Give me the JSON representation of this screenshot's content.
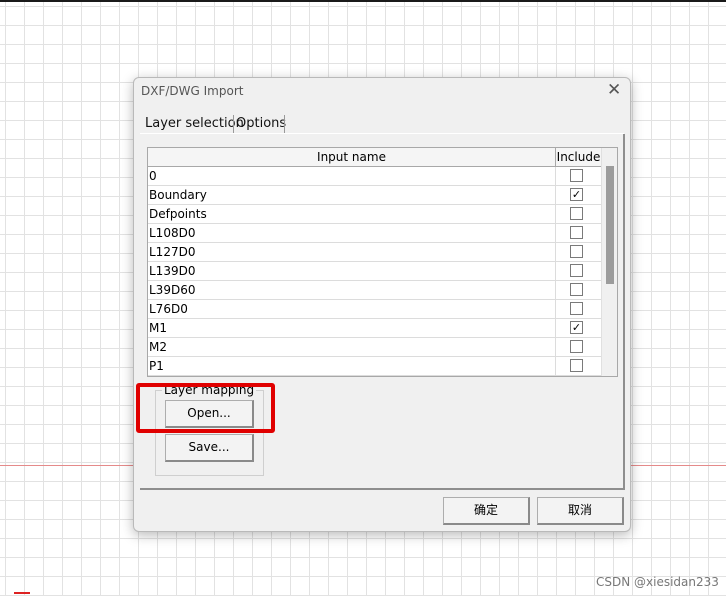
{
  "dialog": {
    "title": "DXF/DWG Import",
    "close_icon": "close-icon",
    "tabs": [
      {
        "label": "Layer selection"
      },
      {
        "label": "Options"
      }
    ],
    "table": {
      "col_name": "Input name",
      "col_include": "Include",
      "rows": [
        {
          "name": "0",
          "checked": false
        },
        {
          "name": "Boundary",
          "checked": true
        },
        {
          "name": "Defpoints",
          "checked": false
        },
        {
          "name": "L108D0",
          "checked": false
        },
        {
          "name": "L127D0",
          "checked": false
        },
        {
          "name": "L139D0",
          "checked": false
        },
        {
          "name": "L39D60",
          "checked": false
        },
        {
          "name": "L76D0",
          "checked": false
        },
        {
          "name": "M1",
          "checked": true
        },
        {
          "name": "M2",
          "checked": false
        },
        {
          "name": "P1",
          "checked": false
        }
      ]
    },
    "layer_mapping": {
      "label": "Layer mapping",
      "open_label": "Open...",
      "save_label": "Save..."
    },
    "ok_label": "确定",
    "cancel_label": "取消"
  },
  "watermark": "CSDN @xiesidan233",
  "colors": {
    "highlight": "#e00000",
    "dialog_bg": "#f0f0f0"
  }
}
